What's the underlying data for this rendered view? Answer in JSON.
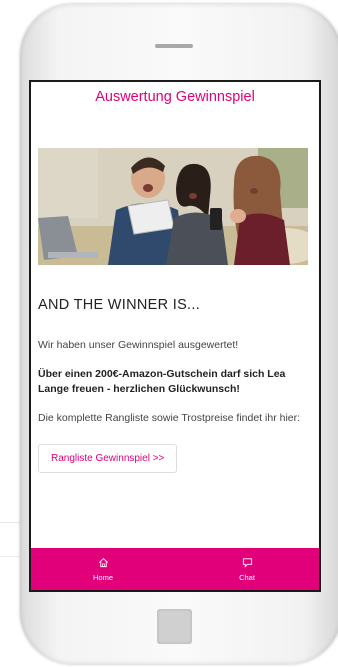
{
  "app": {
    "title": "Auswertung Gewinnspiel"
  },
  "hero_image": {
    "alt": "Three surprised people looking at a tablet"
  },
  "content": {
    "headline": "AND THE WINNER IS...",
    "intro": "Wir haben unser Gewinnspiel ausgewertet!",
    "winner_text": "Über einen 200€-Amazon-Gutschein darf sich Lea Lange freuen - herzlichen Glückwunsch!",
    "ranking_text": "Die komplette Rangliste sowie Trostpreise findet ihr hier:",
    "ranking_button": "Rangliste Gewinnspiel >>"
  },
  "bottom_nav": {
    "home_label": "Home",
    "chat_label": "Chat"
  },
  "colors": {
    "accent": "#e2007a"
  },
  "icons": [
    "home-icon",
    "chat-icon"
  ]
}
